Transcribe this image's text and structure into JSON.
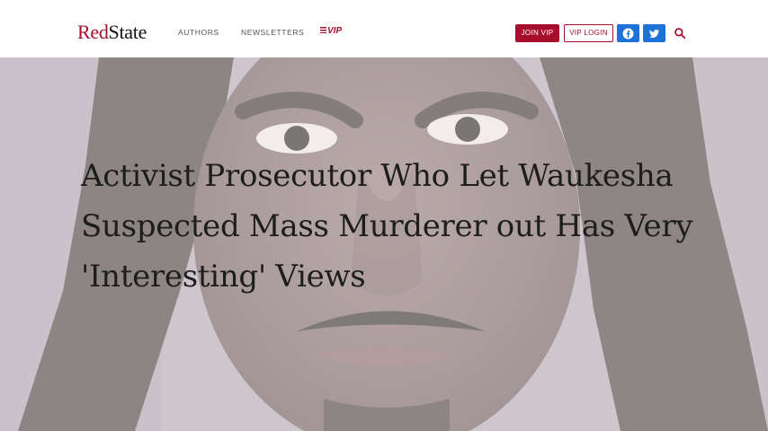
{
  "header": {
    "logo": {
      "part1": "Red",
      "part2": "State"
    },
    "nav": [
      {
        "label": "AUTHORS"
      },
      {
        "label": "NEWSLETTERS"
      }
    ],
    "vip_link": "VIP",
    "join_button": "JOIN VIP",
    "login_button": "VIP LOGIN",
    "social": [
      {
        "icon": "facebook-icon"
      },
      {
        "icon": "twitter-icon"
      }
    ],
    "search_icon": "search-icon"
  },
  "hero": {
    "headline": "Activist Prosecutor Who Let Waukesha Suspected Mass Murderer out Has Very 'Interesting' Views"
  },
  "colors": {
    "brand_red": "#a50f2d",
    "social_blue": "#1d72d8",
    "headline_text": "#1d1d1d"
  }
}
